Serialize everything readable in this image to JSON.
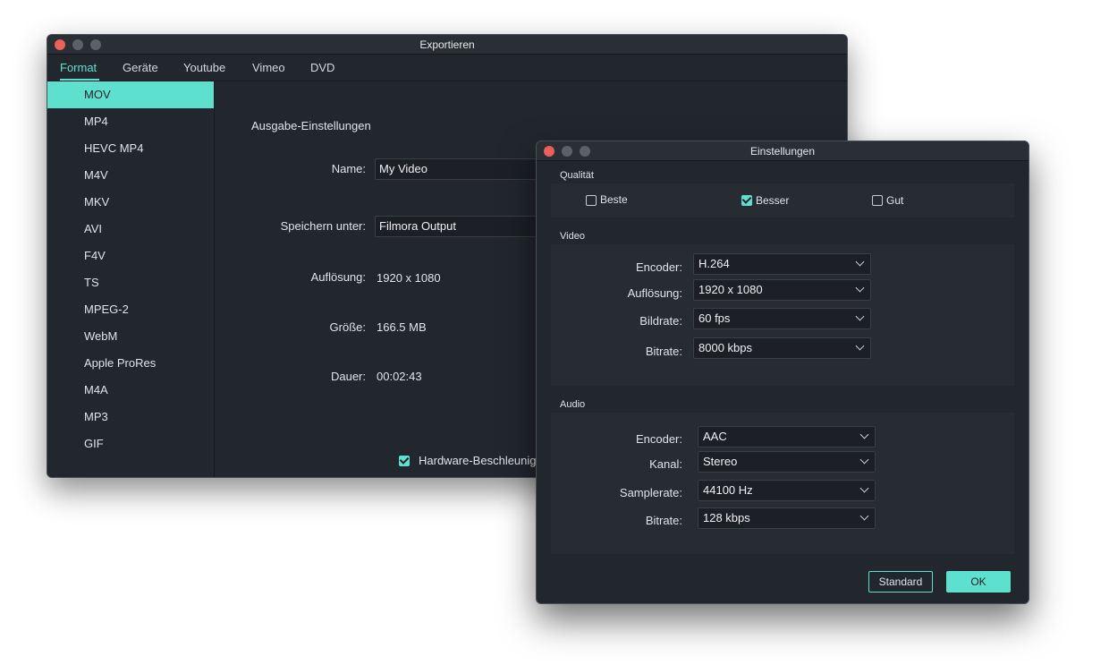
{
  "export_window": {
    "title": "Exportieren",
    "tabs": [
      "Format",
      "Geräte",
      "Youtube",
      "Vimeo",
      "DVD"
    ],
    "formats": [
      "MOV",
      "MP4",
      "HEVC MP4",
      "M4V",
      "MKV",
      "AVI",
      "F4V",
      "TS",
      "MPEG-2",
      "WebM",
      "Apple ProRes",
      "M4A",
      "MP3",
      "GIF"
    ],
    "selected_format": "MOV",
    "output_settings_title": "Ausgabe-Einstellungen",
    "name_label": "Name:",
    "name_value": "My Video",
    "save_label": "Speichern unter:",
    "save_value": "Filmora Output",
    "resolution_label": "Auflösung:",
    "resolution_value": "1920 x 1080",
    "size_label": "Größe:",
    "size_value": "166.5 MB",
    "duration_label": "Dauer:",
    "duration_value": "00:02:43",
    "hw_accel_label": "Hardware-Beschleunigu",
    "hw_accel_checked": true
  },
  "settings_window": {
    "title": "Einstellungen",
    "quality_section": "Qualität",
    "quality_options": [
      {
        "label": "Beste",
        "checked": false
      },
      {
        "label": "Besser",
        "checked": true
      },
      {
        "label": "Gut",
        "checked": false
      }
    ],
    "video_section": "Video",
    "video": {
      "encoder_label": "Encoder:",
      "encoder_value": "H.264",
      "resolution_label": "Auflösung:",
      "resolution_value": "1920 x 1080",
      "framerate_label": "Bildrate:",
      "framerate_value": "60 fps",
      "bitrate_label": "Bitrate:",
      "bitrate_value": "8000 kbps"
    },
    "audio_section": "Audio",
    "audio": {
      "encoder_label": "Encoder:",
      "encoder_value": "AAC",
      "channel_label": "Kanal:",
      "channel_value": "Stereo",
      "samplerate_label": "Samplerate:",
      "samplerate_value": "44100 Hz",
      "bitrate_label": "Bitrate:",
      "bitrate_value": "128 kbps"
    },
    "standard_button": "Standard",
    "ok_button": "OK"
  },
  "colors": {
    "accent": "#5ee0cf",
    "window_bg": "#22272e",
    "panel_bg": "#272c33",
    "close_red": "#ed5f57"
  }
}
